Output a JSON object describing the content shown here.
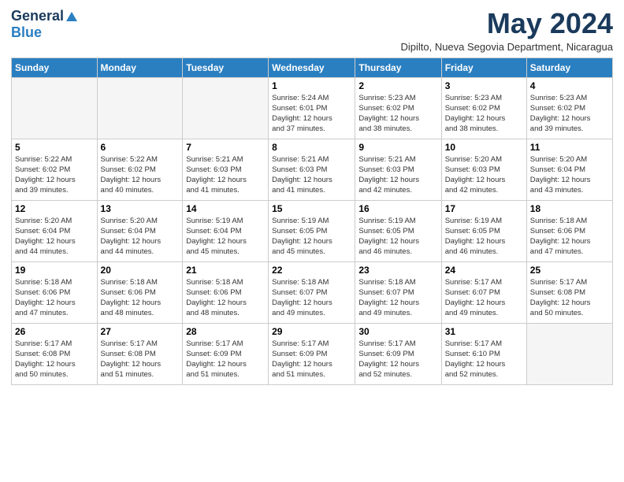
{
  "logo": {
    "general": "General",
    "blue": "Blue",
    "aria": "GeneralBlue logo"
  },
  "header": {
    "month_title": "May 2024",
    "subtitle": "Dipilto, Nueva Segovia Department, Nicaragua"
  },
  "weekdays": [
    "Sunday",
    "Monday",
    "Tuesday",
    "Wednesday",
    "Thursday",
    "Friday",
    "Saturday"
  ],
  "weeks": [
    [
      {
        "day": "",
        "info": ""
      },
      {
        "day": "",
        "info": ""
      },
      {
        "day": "",
        "info": ""
      },
      {
        "day": "1",
        "info": "Sunrise: 5:24 AM\nSunset: 6:01 PM\nDaylight: 12 hours\nand 37 minutes."
      },
      {
        "day": "2",
        "info": "Sunrise: 5:23 AM\nSunset: 6:02 PM\nDaylight: 12 hours\nand 38 minutes."
      },
      {
        "day": "3",
        "info": "Sunrise: 5:23 AM\nSunset: 6:02 PM\nDaylight: 12 hours\nand 38 minutes."
      },
      {
        "day": "4",
        "info": "Sunrise: 5:23 AM\nSunset: 6:02 PM\nDaylight: 12 hours\nand 39 minutes."
      }
    ],
    [
      {
        "day": "5",
        "info": "Sunrise: 5:22 AM\nSunset: 6:02 PM\nDaylight: 12 hours\nand 39 minutes."
      },
      {
        "day": "6",
        "info": "Sunrise: 5:22 AM\nSunset: 6:02 PM\nDaylight: 12 hours\nand 40 minutes."
      },
      {
        "day": "7",
        "info": "Sunrise: 5:21 AM\nSunset: 6:03 PM\nDaylight: 12 hours\nand 41 minutes."
      },
      {
        "day": "8",
        "info": "Sunrise: 5:21 AM\nSunset: 6:03 PM\nDaylight: 12 hours\nand 41 minutes."
      },
      {
        "day": "9",
        "info": "Sunrise: 5:21 AM\nSunset: 6:03 PM\nDaylight: 12 hours\nand 42 minutes."
      },
      {
        "day": "10",
        "info": "Sunrise: 5:20 AM\nSunset: 6:03 PM\nDaylight: 12 hours\nand 42 minutes."
      },
      {
        "day": "11",
        "info": "Sunrise: 5:20 AM\nSunset: 6:04 PM\nDaylight: 12 hours\nand 43 minutes."
      }
    ],
    [
      {
        "day": "12",
        "info": "Sunrise: 5:20 AM\nSunset: 6:04 PM\nDaylight: 12 hours\nand 44 minutes."
      },
      {
        "day": "13",
        "info": "Sunrise: 5:20 AM\nSunset: 6:04 PM\nDaylight: 12 hours\nand 44 minutes."
      },
      {
        "day": "14",
        "info": "Sunrise: 5:19 AM\nSunset: 6:04 PM\nDaylight: 12 hours\nand 45 minutes."
      },
      {
        "day": "15",
        "info": "Sunrise: 5:19 AM\nSunset: 6:05 PM\nDaylight: 12 hours\nand 45 minutes."
      },
      {
        "day": "16",
        "info": "Sunrise: 5:19 AM\nSunset: 6:05 PM\nDaylight: 12 hours\nand 46 minutes."
      },
      {
        "day": "17",
        "info": "Sunrise: 5:19 AM\nSunset: 6:05 PM\nDaylight: 12 hours\nand 46 minutes."
      },
      {
        "day": "18",
        "info": "Sunrise: 5:18 AM\nSunset: 6:06 PM\nDaylight: 12 hours\nand 47 minutes."
      }
    ],
    [
      {
        "day": "19",
        "info": "Sunrise: 5:18 AM\nSunset: 6:06 PM\nDaylight: 12 hours\nand 47 minutes."
      },
      {
        "day": "20",
        "info": "Sunrise: 5:18 AM\nSunset: 6:06 PM\nDaylight: 12 hours\nand 48 minutes."
      },
      {
        "day": "21",
        "info": "Sunrise: 5:18 AM\nSunset: 6:06 PM\nDaylight: 12 hours\nand 48 minutes."
      },
      {
        "day": "22",
        "info": "Sunrise: 5:18 AM\nSunset: 6:07 PM\nDaylight: 12 hours\nand 49 minutes."
      },
      {
        "day": "23",
        "info": "Sunrise: 5:18 AM\nSunset: 6:07 PM\nDaylight: 12 hours\nand 49 minutes."
      },
      {
        "day": "24",
        "info": "Sunrise: 5:17 AM\nSunset: 6:07 PM\nDaylight: 12 hours\nand 49 minutes."
      },
      {
        "day": "25",
        "info": "Sunrise: 5:17 AM\nSunset: 6:08 PM\nDaylight: 12 hours\nand 50 minutes."
      }
    ],
    [
      {
        "day": "26",
        "info": "Sunrise: 5:17 AM\nSunset: 6:08 PM\nDaylight: 12 hours\nand 50 minutes."
      },
      {
        "day": "27",
        "info": "Sunrise: 5:17 AM\nSunset: 6:08 PM\nDaylight: 12 hours\nand 51 minutes."
      },
      {
        "day": "28",
        "info": "Sunrise: 5:17 AM\nSunset: 6:09 PM\nDaylight: 12 hours\nand 51 minutes."
      },
      {
        "day": "29",
        "info": "Sunrise: 5:17 AM\nSunset: 6:09 PM\nDaylight: 12 hours\nand 51 minutes."
      },
      {
        "day": "30",
        "info": "Sunrise: 5:17 AM\nSunset: 6:09 PM\nDaylight: 12 hours\nand 52 minutes."
      },
      {
        "day": "31",
        "info": "Sunrise: 5:17 AM\nSunset: 6:10 PM\nDaylight: 12 hours\nand 52 minutes."
      },
      {
        "day": "",
        "info": ""
      }
    ]
  ]
}
